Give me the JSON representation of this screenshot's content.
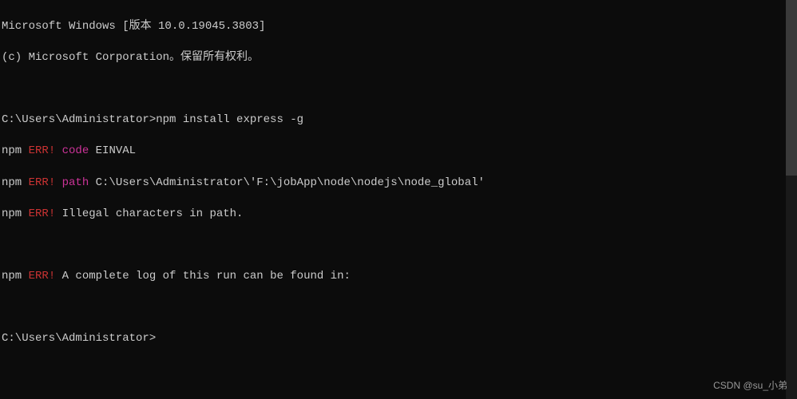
{
  "header": {
    "line1": "Microsoft Windows [版本 10.0.19045.3803]",
    "line2": "(c) Microsoft Corporation。保留所有权利。"
  },
  "session": {
    "prompt1": "C:\\Users\\Administrator>",
    "command1": "npm install express -g",
    "errors": [
      {
        "prefix": "npm ",
        "tag": "ERR! ",
        "key": "code",
        "rest": " EINVAL"
      },
      {
        "prefix": "npm ",
        "tag": "ERR! ",
        "key": "path",
        "rest": " C:\\Users\\Administrator\\'F:\\jobApp\\node\\nodejs\\node_global'"
      },
      {
        "prefix": "npm ",
        "tag": "ERR! ",
        "key": "",
        "rest": "Illegal characters in path."
      }
    ],
    "log_line": {
      "prefix": "npm ",
      "tag": "ERR! ",
      "rest": "A complete log of this run can be found in:"
    },
    "prompt2": "C:\\Users\\Administrator>"
  },
  "watermark": "CSDN @su_小弟"
}
